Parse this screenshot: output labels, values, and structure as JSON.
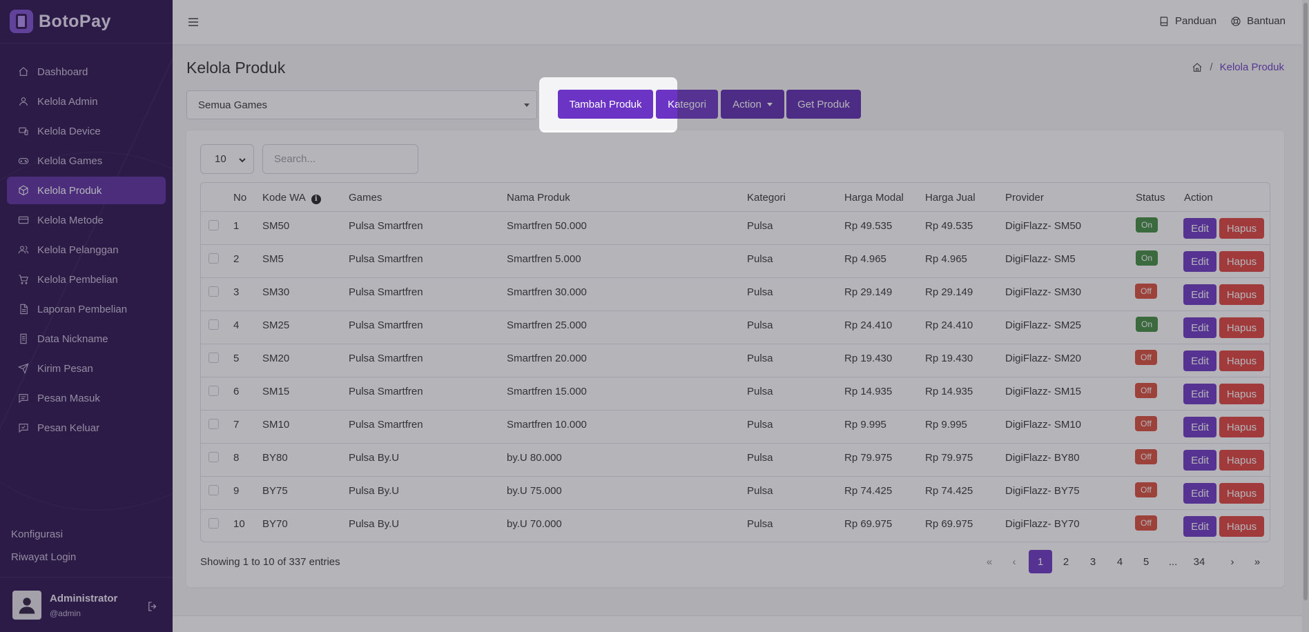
{
  "brand": {
    "name": "BotoPay"
  },
  "sidebar": {
    "items": [
      {
        "label": "Dashboard",
        "icon": "home-icon"
      },
      {
        "label": "Kelola Admin",
        "icon": "user-icon"
      },
      {
        "label": "Kelola Device",
        "icon": "device-icon"
      },
      {
        "label": "Kelola Games",
        "icon": "gamepad-icon"
      },
      {
        "label": "Kelola Produk",
        "icon": "box-icon",
        "active": true
      },
      {
        "label": "Kelola Metode",
        "icon": "card-icon"
      },
      {
        "label": "Kelola Pelanggan",
        "icon": "users-icon"
      },
      {
        "label": "Kelola Pembelian",
        "icon": "cart-icon"
      },
      {
        "label": "Laporan Pembelian",
        "icon": "file-icon"
      },
      {
        "label": "Data Nickname",
        "icon": "document-icon"
      },
      {
        "label": "Kirim Pesan",
        "icon": "send-icon"
      },
      {
        "label": "Pesan Masuk",
        "icon": "message-icon"
      },
      {
        "label": "Pesan Keluar",
        "icon": "message-out-icon"
      }
    ],
    "links": {
      "config": "Konfigurasi",
      "login_history": "Riwayat Login"
    },
    "user": {
      "name": "Administrator",
      "handle": "@admin"
    }
  },
  "header": {
    "guide": "Panduan",
    "help": "Bantuan"
  },
  "page": {
    "title": "Kelola Produk",
    "breadcrumb_current": "Kelola Produk",
    "breadcrumb_sep": "/"
  },
  "toolbar": {
    "filter_value": "Semua Games",
    "add_label": "Tambah Produk",
    "category_label": "Kategori",
    "action_label": "Action",
    "get_label": "Get Produk"
  },
  "table_controls": {
    "page_size": "10",
    "search_placeholder": "Search..."
  },
  "table": {
    "headers": {
      "no": "No",
      "kode": "Kode WA",
      "games": "Games",
      "nama": "Nama Produk",
      "kategori": "Kategori",
      "modal": "Harga Modal",
      "jual": "Harga Jual",
      "provider": "Provider",
      "status": "Status",
      "action": "Action"
    },
    "edit_label": "Edit",
    "delete_label": "Hapus",
    "rows": [
      {
        "no": "1",
        "kode": "SM50",
        "games": "Pulsa Smartfren",
        "nama": "Smartfren 50.000",
        "kategori": "Pulsa",
        "modal": "Rp 49.535",
        "jual": "Rp 49.535",
        "provider": "DigiFlazz- SM50",
        "status": "On"
      },
      {
        "no": "2",
        "kode": "SM5",
        "games": "Pulsa Smartfren",
        "nama": "Smartfren 5.000",
        "kategori": "Pulsa",
        "modal": "Rp 4.965",
        "jual": "Rp 4.965",
        "provider": "DigiFlazz- SM5",
        "status": "On"
      },
      {
        "no": "3",
        "kode": "SM30",
        "games": "Pulsa Smartfren",
        "nama": "Smartfren 30.000",
        "kategori": "Pulsa",
        "modal": "Rp 29.149",
        "jual": "Rp 29.149",
        "provider": "DigiFlazz- SM30",
        "status": "Off"
      },
      {
        "no": "4",
        "kode": "SM25",
        "games": "Pulsa Smartfren",
        "nama": "Smartfren 25.000",
        "kategori": "Pulsa",
        "modal": "Rp 24.410",
        "jual": "Rp 24.410",
        "provider": "DigiFlazz- SM25",
        "status": "On"
      },
      {
        "no": "5",
        "kode": "SM20",
        "games": "Pulsa Smartfren",
        "nama": "Smartfren 20.000",
        "kategori": "Pulsa",
        "modal": "Rp 19.430",
        "jual": "Rp 19.430",
        "provider": "DigiFlazz- SM20",
        "status": "Off"
      },
      {
        "no": "6",
        "kode": "SM15",
        "games": "Pulsa Smartfren",
        "nama": "Smartfren 15.000",
        "kategori": "Pulsa",
        "modal": "Rp 14.935",
        "jual": "Rp 14.935",
        "provider": "DigiFlazz- SM15",
        "status": "Off"
      },
      {
        "no": "7",
        "kode": "SM10",
        "games": "Pulsa Smartfren",
        "nama": "Smartfren 10.000",
        "kategori": "Pulsa",
        "modal": "Rp 9.995",
        "jual": "Rp 9.995",
        "provider": "DigiFlazz- SM10",
        "status": "Off"
      },
      {
        "no": "8",
        "kode": "BY80",
        "games": "Pulsa By.U",
        "nama": "by.U 80.000",
        "kategori": "Pulsa",
        "modal": "Rp 79.975",
        "jual": "Rp 79.975",
        "provider": "DigiFlazz- BY80",
        "status": "Off"
      },
      {
        "no": "9",
        "kode": "BY75",
        "games": "Pulsa By.U",
        "nama": "by.U 75.000",
        "kategori": "Pulsa",
        "modal": "Rp 74.425",
        "jual": "Rp 74.425",
        "provider": "DigiFlazz- BY75",
        "status": "Off"
      },
      {
        "no": "10",
        "kode": "BY70",
        "games": "Pulsa By.U",
        "nama": "by.U 70.000",
        "kategori": "Pulsa",
        "modal": "Rp 69.975",
        "jual": "Rp 69.975",
        "provider": "DigiFlazz- BY70",
        "status": "Off"
      }
    ]
  },
  "footer": {
    "showing": "Showing 1 to 10 of 337 entries"
  },
  "pagination": {
    "first": "«",
    "prev": "‹",
    "pages": [
      "1",
      "2",
      "3",
      "4",
      "5",
      "...",
      "34"
    ],
    "next": "›",
    "last": "»",
    "active": "1"
  },
  "colors": {
    "sidebar_bg": "#2a0f4d",
    "accent": "#6b34c4",
    "status_on": "#3f8a3f",
    "status_off": "#d94b3b",
    "delete": "#e0403a"
  }
}
